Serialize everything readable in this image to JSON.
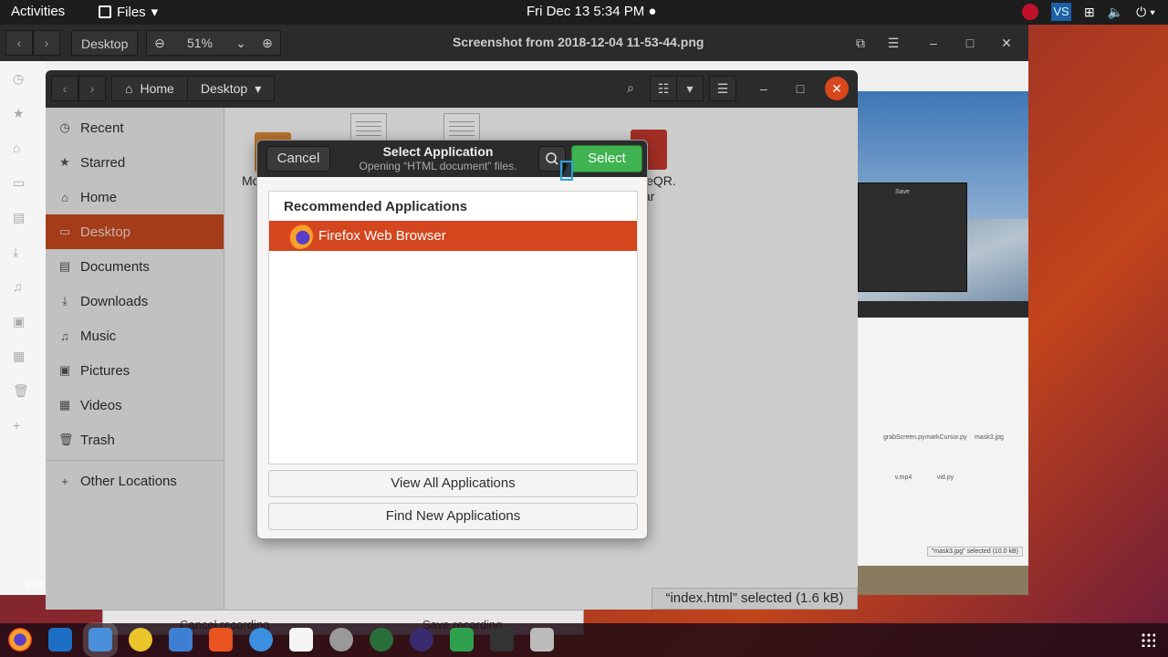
{
  "topbar": {
    "activities": "Activities",
    "app_menu": "Files",
    "clock": "Fri Dec 13   5:34 PM ●",
    "vs_label": "VS"
  },
  "viewer": {
    "breadcrumb": "Desktop",
    "zoom": "51%",
    "title": "Screenshot from 2018-12-04 11-53-44.png",
    "embedded": {
      "save": "Save",
      "files": [
        "grabScreen.py",
        "markCursor.py",
        "mask3.jpg",
        "v.mp4",
        "vid.py"
      ],
      "status": "\"mask3.jpg\" selected (10.0 kB)"
    }
  },
  "files_window": {
    "path": [
      "Home",
      "Desktop"
    ],
    "sidebar": [
      {
        "label": "Recent",
        "icon": "clock-icon"
      },
      {
        "label": "Starred",
        "icon": "star-icon"
      },
      {
        "label": "Home",
        "icon": "home-icon"
      },
      {
        "label": "Desktop",
        "icon": "desktop-icon",
        "active": true
      },
      {
        "label": "Documents",
        "icon": "document-icon"
      },
      {
        "label": "Downloads",
        "icon": "download-icon"
      },
      {
        "label": "Music",
        "icon": "music-icon"
      },
      {
        "label": "Pictures",
        "icon": "picture-icon"
      },
      {
        "label": "Videos",
        "icon": "video-icon"
      },
      {
        "label": "Trash",
        "icon": "trash-icon"
      },
      {
        "label": "Other Locations",
        "icon": "plus-icon"
      }
    ],
    "content_labels": {
      "left": "Mo",
      "right": "leQR.",
      "right2": "ar"
    },
    "status": "“index.html” selected  (1.6 kB)"
  },
  "dialog": {
    "cancel": "Cancel",
    "title": "Select Application",
    "subtitle": "Opening “HTML document” files.",
    "select": "Select",
    "section": "Recommended Applications",
    "apps": [
      "Firefox Web Browser"
    ],
    "view_all": "View All Applications",
    "find_new": "Find New Applications"
  },
  "background": {
    "left_label": "ind",
    "rec_cancel": "Cancel recording",
    "rec_save": "Save recording"
  },
  "colors": {
    "accent": "#d4461d",
    "select_green": "#3eb34f",
    "topbar": "#1d1d1d"
  }
}
